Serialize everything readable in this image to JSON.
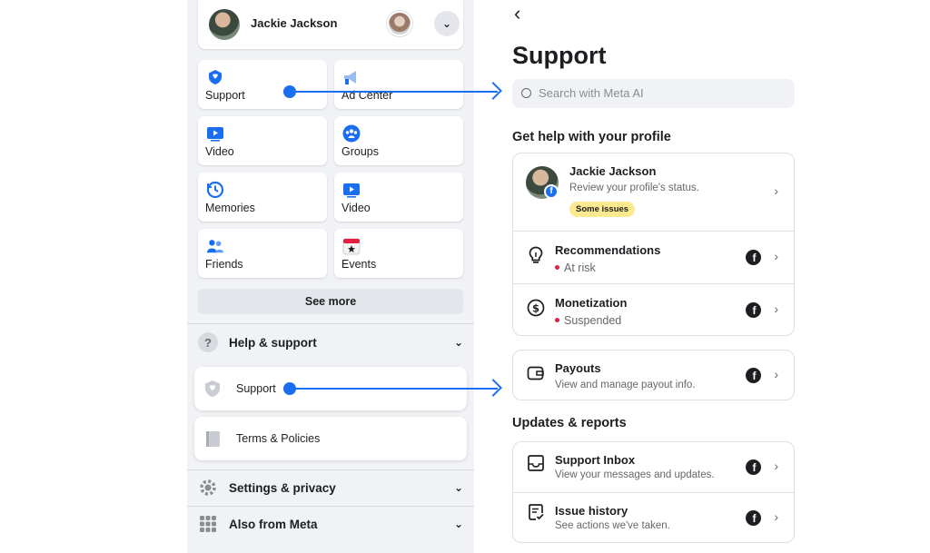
{
  "left_menu": {
    "profile": {
      "name": "Jackie Jackson"
    },
    "tiles": [
      {
        "label": "Support",
        "icon": "support-shield-icon"
      },
      {
        "label": "Ad Center",
        "icon": "megaphone-icon"
      },
      {
        "label": "Video",
        "icon": "video-play-icon"
      },
      {
        "label": "Groups",
        "icon": "groups-icon"
      },
      {
        "label": "Memories",
        "icon": "memories-clock-icon"
      },
      {
        "label": "Video",
        "icon": "video-play-icon"
      },
      {
        "label": "Friends",
        "icon": "friends-icon"
      },
      {
        "label": "Events",
        "icon": "calendar-star-icon"
      }
    ],
    "see_more": "See more",
    "help_support": {
      "label": "Help & support",
      "icon": "question-icon"
    },
    "support_item": "Support",
    "terms_item": "Terms & Policies",
    "settings_privacy": {
      "label": "Settings & privacy",
      "icon": "gear-icon"
    },
    "also_from_meta": {
      "label": "Also from Meta",
      "icon": "grid-icon"
    }
  },
  "support_page": {
    "back_icon": "back-arrow-icon",
    "title": "Support",
    "search_placeholder": "Search with Meta AI",
    "profile_section_title": "Get help with your profile",
    "profile_row": {
      "name": "Jackie Jackson",
      "subtitle": "Review your profile's status.",
      "badge": "Some issues"
    },
    "recommendations": {
      "title": "Recommendations",
      "status": "At risk"
    },
    "monetization": {
      "title": "Monetization",
      "status": "Suspended"
    },
    "payouts": {
      "title": "Payouts",
      "subtitle": "View and manage payout info."
    },
    "updates_section_title": "Updates & reports",
    "support_inbox": {
      "title": "Support Inbox",
      "subtitle": "View your messages and updates."
    },
    "issue_history": {
      "title": "Issue history",
      "subtitle": "See actions we've taken."
    }
  },
  "colors": {
    "accent_blue": "#1a6ff0",
    "status_red": "#e41e3f",
    "badge_yellow": "#fde98f",
    "panel_gray": "#f0f2f5"
  }
}
